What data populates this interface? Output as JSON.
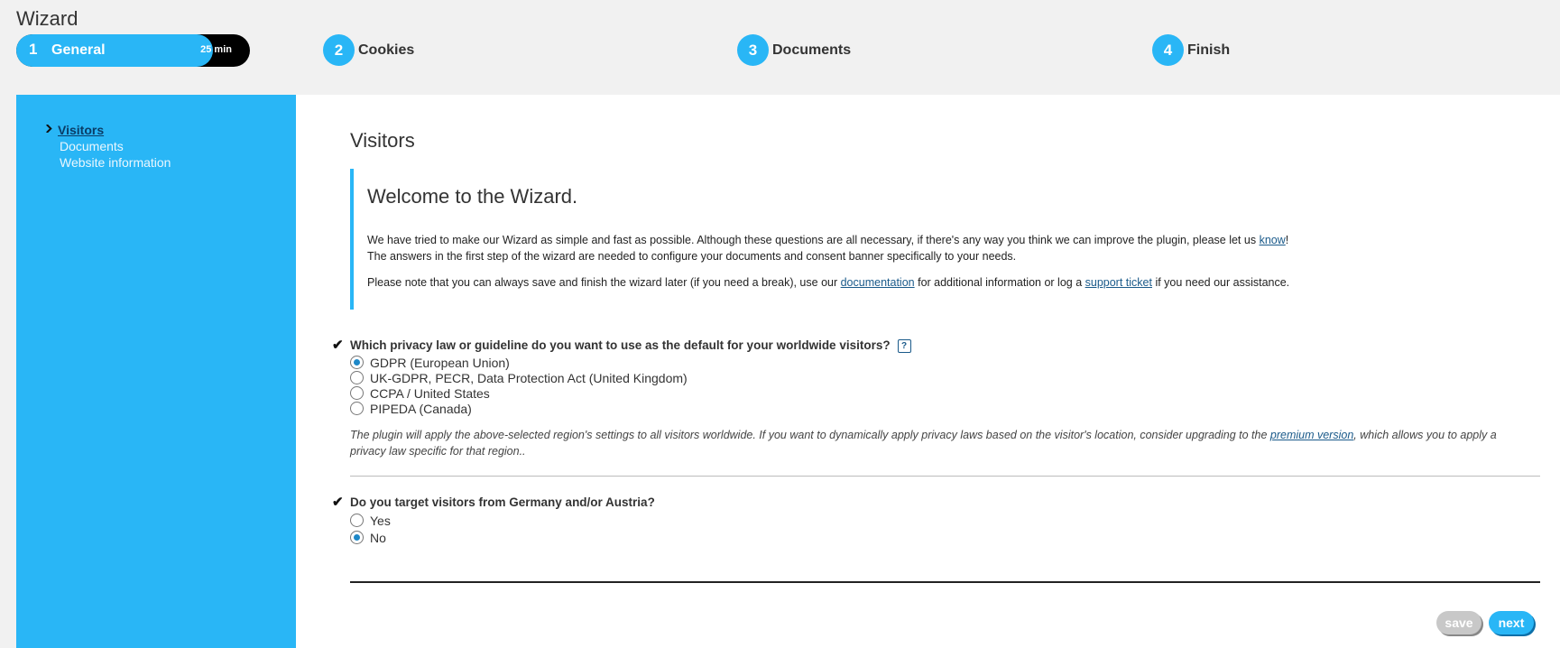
{
  "title": "Wizard",
  "steps": [
    {
      "num": "1",
      "label": "General",
      "time": "25 min"
    },
    {
      "num": "2",
      "label": "Cookies"
    },
    {
      "num": "3",
      "label": "Documents"
    },
    {
      "num": "4",
      "label": "Finish"
    }
  ],
  "sidebar": {
    "items": [
      {
        "label": "Visitors"
      },
      {
        "label": "Documents"
      },
      {
        "label": "Website information"
      }
    ]
  },
  "main": {
    "heading": "Visitors",
    "welcome": {
      "title": "Welcome to the Wizard.",
      "p1_text": "We have tried to make our Wizard as simple and fast as possible. Although these questions are all necessary, if there's any way you think we can improve the plugin, please let us ",
      "p1_link": "know",
      "p1_end": "!",
      "p2": "The answers in the first step of the wizard are needed to configure your documents and consent banner specifically to your needs.",
      "p3_a": "Please note that you can always save and finish the wizard later (if you need a break), use our ",
      "p3_link1": "documentation",
      "p3_b": " for additional information or log a ",
      "p3_link2": "support ticket",
      "p3_c": " if you need our assistance."
    },
    "q1": {
      "label": "Which privacy law or guideline do you want to use as the default for your worldwide visitors?",
      "help": "?",
      "options": [
        {
          "label": "GDPR (European Union)",
          "selected": true
        },
        {
          "label": "UK-GDPR, PECR, Data Protection Act (United Kingdom)",
          "selected": false
        },
        {
          "label": "CCPA / United States",
          "selected": false
        },
        {
          "label": "PIPEDA (Canada)",
          "selected": false
        }
      ],
      "note_a": "The plugin will apply the above-selected region's settings to all visitors worldwide. If you want to dynamically apply privacy laws based on the visitor's location, consider upgrading to the ",
      "note_link": "premium version",
      "note_b": ", which allows you to apply a privacy law specific for that region.."
    },
    "q2": {
      "label": "Do you target visitors from Germany and/or Austria?",
      "options": [
        {
          "label": "Yes",
          "selected": false
        },
        {
          "label": "No",
          "selected": true
        }
      ]
    },
    "buttons": {
      "save": "save",
      "next": "next"
    }
  },
  "colors": {
    "accent": "#29b6f6",
    "link": "#1a5a8a"
  }
}
